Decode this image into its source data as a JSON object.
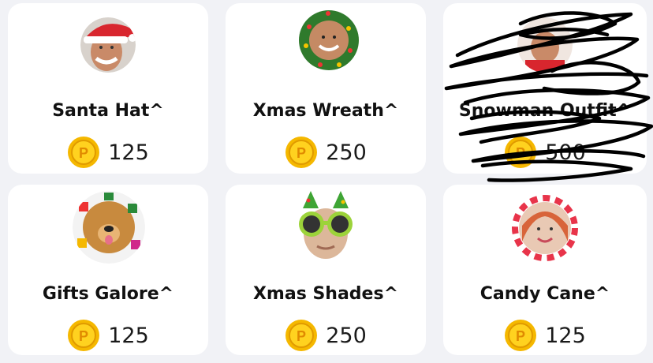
{
  "items": [
    {
      "name": "Santa Hat^",
      "price": "125",
      "icon": "santa-hat-avatar"
    },
    {
      "name": "Xmas Wreath^",
      "price": "250",
      "icon": "xmas-wreath-avatar"
    },
    {
      "name": "Snowman Outfit^",
      "price": "500",
      "icon": "snowman-outfit-avatar"
    },
    {
      "name": "Gifts Galore^",
      "price": "125",
      "icon": "gifts-galore-avatar"
    },
    {
      "name": "Xmas Shades^",
      "price": "250",
      "icon": "xmas-shades-avatar"
    },
    {
      "name": "Candy Cane^",
      "price": "125",
      "icon": "candy-cane-avatar"
    }
  ],
  "currency": {
    "icon": "coin-icon",
    "symbol": "P",
    "color": "#f7c400"
  },
  "colors": {
    "background": "#f1f2f6",
    "card": "#ffffff",
    "text": "#111111"
  }
}
